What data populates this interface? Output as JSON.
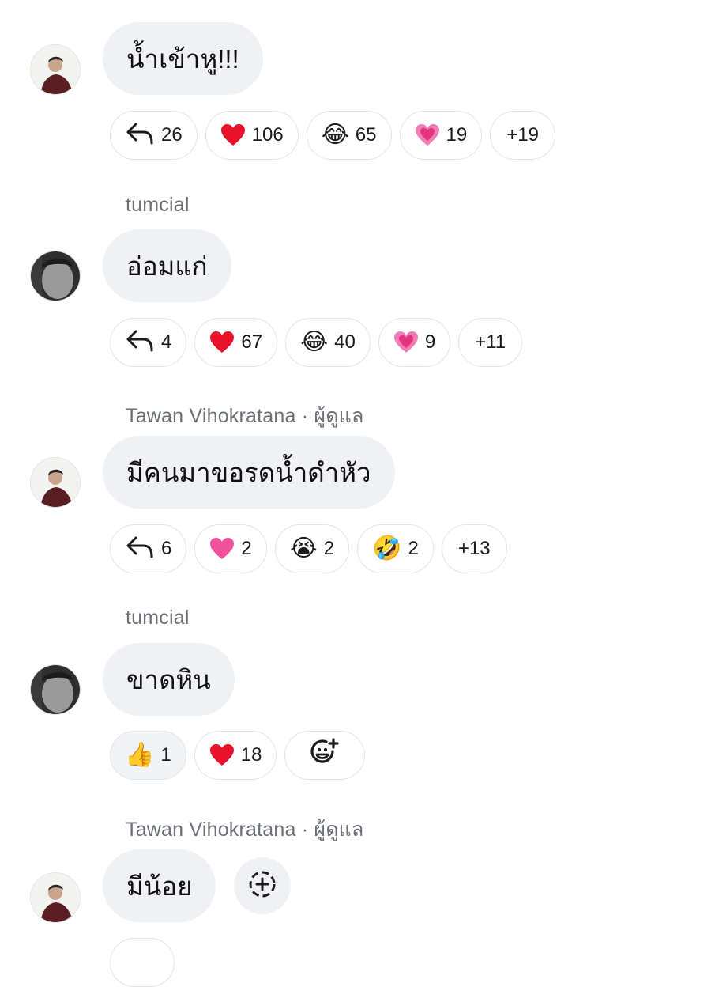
{
  "messages": [
    {
      "sender": "",
      "text": "น้ำเข้าหู!!!",
      "avatar": "avatar-man-red-shirt",
      "reactions": [
        {
          "icon": "reply-icon",
          "count": "26"
        },
        {
          "icon": "red-heart-emoji",
          "glyph": "❤️",
          "count": "106"
        },
        {
          "icon": "tears-of-joy-emoji",
          "glyph": "😂",
          "count": "65"
        },
        {
          "icon": "growing-heart-emoji",
          "glyph": "💗",
          "count": "19"
        },
        {
          "label": "+19"
        }
      ]
    },
    {
      "sender": "tumcial",
      "text": "อ่อมแก่",
      "avatar": "avatar-boy-grayscale",
      "reactions": [
        {
          "icon": "reply-icon",
          "count": "4"
        },
        {
          "icon": "red-heart-emoji",
          "glyph": "❤️",
          "count": "67"
        },
        {
          "icon": "tears-of-joy-emoji",
          "glyph": "😂",
          "count": "40"
        },
        {
          "icon": "growing-heart-emoji",
          "glyph": "💗",
          "count": "9"
        },
        {
          "label": "+11"
        }
      ]
    },
    {
      "sender": "Tawan Vihokratana · ผู้ดูแล",
      "text": "มีคนมาขอรดน้ำดำหัว",
      "avatar": "avatar-man-red-shirt",
      "reactions": [
        {
          "icon": "reply-icon",
          "count": "6"
        },
        {
          "icon": "pink-heart-emoji",
          "glyph": "💗",
          "count": "2"
        },
        {
          "icon": "crying-face-emoji",
          "glyph": "😭",
          "count": "2"
        },
        {
          "icon": "rofl-emoji",
          "glyph": "🤣",
          "count": "2"
        },
        {
          "label": "+13"
        }
      ]
    },
    {
      "sender": "tumcial",
      "text": "ขาดหิน",
      "avatar": "avatar-boy-grayscale",
      "reactions": [
        {
          "icon": "thumbs-up-emoji",
          "glyph": "👍",
          "count": "1",
          "selected": true
        },
        {
          "icon": "red-heart-emoji",
          "glyph": "❤️",
          "count": "18"
        },
        {
          "icon": "add-reaction-icon"
        }
      ]
    },
    {
      "sender": "Tawan Vihokratana · ผู้ดูแล",
      "text": "มีน้อย",
      "avatar": "avatar-man-red-shirt"
    }
  ],
  "colors": {
    "bubble": "#f0f1f4",
    "sender_text": "#6b6f76",
    "pill_border": "#e3e4e8",
    "heart": "#e8132b",
    "pink_heart": "#f0529c",
    "emoji_yellow": "#f7c02b"
  }
}
